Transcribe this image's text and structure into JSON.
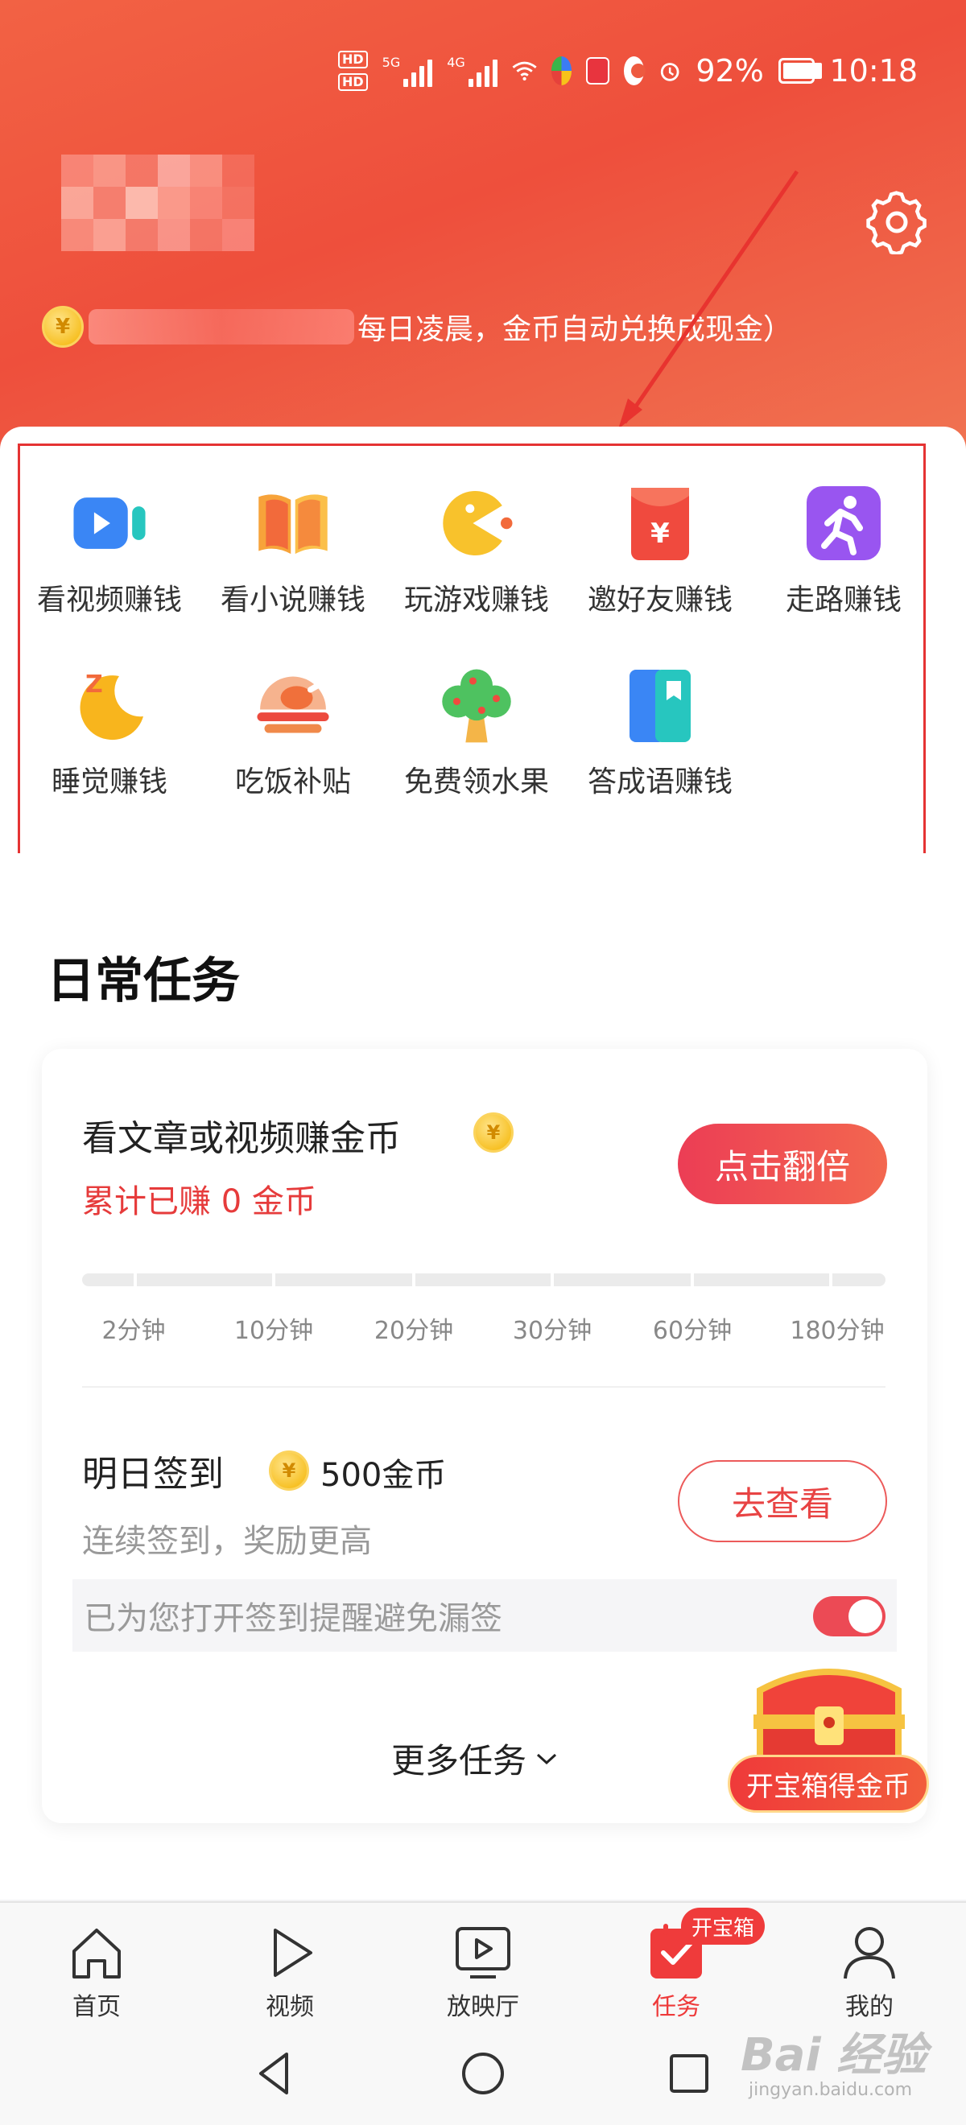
{
  "status_bar": {
    "battery": "92%",
    "time": "10:18",
    "sim1": "HD",
    "sim2": "HD",
    "net1": "5G",
    "net2": "4G"
  },
  "header": {
    "coin_notice": "每日凌晨，金币自动兑换成现金）"
  },
  "earn_grid": [
    {
      "label": "看视频赚钱",
      "icon": "video-camera-icon"
    },
    {
      "label": "看小说赚钱",
      "icon": "book-icon"
    },
    {
      "label": "玩游戏赚钱",
      "icon": "pacman-icon"
    },
    {
      "label": "邀好友赚钱",
      "icon": "red-envelope-icon"
    },
    {
      "label": "走路赚钱",
      "icon": "running-icon"
    },
    {
      "label": "睡觉赚钱",
      "icon": "moon-icon"
    },
    {
      "label": "吃饭补贴",
      "icon": "chicken-icon"
    },
    {
      "label": "免费领水果",
      "icon": "fruit-tree-icon"
    },
    {
      "label": "答成语赚钱",
      "icon": "idiom-book-icon"
    }
  ],
  "daily": {
    "title": "日常任务",
    "task1": {
      "title": "看文章或视频赚金币",
      "earned": "累计已赚 0 金币",
      "button": "点击翻倍",
      "ticks": [
        "2分钟",
        "10分钟",
        "20分钟",
        "30分钟",
        "60分钟",
        "180分钟"
      ],
      "progress": 0
    },
    "task2": {
      "title": "明日签到",
      "reward": "500金币",
      "subtitle": "连续签到，奖励更高",
      "button": "去查看",
      "reminder": "已为您打开签到提醒避免漏签",
      "reminder_on": true
    },
    "more": "更多任务",
    "chest_label": "开宝箱得金币"
  },
  "tabs": [
    {
      "label": "首页",
      "icon": "home-icon"
    },
    {
      "label": "视频",
      "icon": "play-icon"
    },
    {
      "label": "放映厅",
      "icon": "screen-play-icon"
    },
    {
      "label": "任务",
      "icon": "task-check-icon",
      "active": true,
      "badge": "开宝箱"
    },
    {
      "label": "我的",
      "icon": "user-icon"
    }
  ],
  "coin_symbol": "¥",
  "watermark": {
    "logo": "Bai 经验",
    "url": "jingyan.baidu.com"
  },
  "colors": {
    "accent": "#ee3a3a",
    "header": "#ef5a40"
  }
}
